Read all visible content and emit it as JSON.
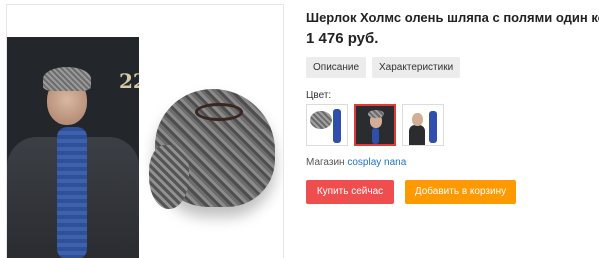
{
  "product": {
    "title": "Шерлок Холмс олень шляпа с полями один комплект",
    "price": "1 476 руб.",
    "door_number": "22"
  },
  "tabs": [
    {
      "label": "Описание"
    },
    {
      "label": "Характеристики"
    }
  ],
  "color": {
    "label": "Цвет:",
    "selected_index": 1
  },
  "shop": {
    "prefix": "Магазин",
    "name": "cosplay nana"
  },
  "actions": {
    "buy_label": "Купить сейчас",
    "cart_label": "Добавить в корзину"
  },
  "colors": {
    "buy_button": "#f04e4e",
    "cart_button": "#ff9900",
    "link": "#1f72c9",
    "selected_border": "#e03a3a"
  }
}
